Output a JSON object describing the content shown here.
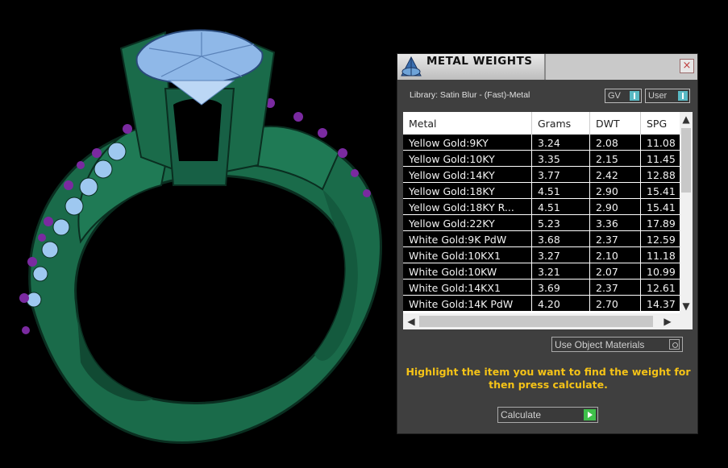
{
  "panel": {
    "title": "METAL WEIGHTS",
    "close_label": "×",
    "library_label": "Library: Satin Blur - (Fast)-Metal",
    "toggle_gv": "GV",
    "toggle_user": "User",
    "use_object_materials": "Use Object Materials",
    "hint": "Highlight the item you want to find the weight for then press calculate.",
    "calculate_label": "Calculate"
  },
  "table": {
    "columns": [
      "Metal",
      "Grams",
      "DWT",
      "SPG"
    ],
    "rows": [
      [
        "Yellow Gold:9KY",
        "3.24",
        "2.08",
        "11.08"
      ],
      [
        "Yellow Gold:10KY",
        "3.35",
        "2.15",
        "11.45"
      ],
      [
        "Yellow Gold:14KY",
        "3.77",
        "2.42",
        "12.88"
      ],
      [
        "Yellow Gold:18KY",
        "4.51",
        "2.90",
        "15.41"
      ],
      [
        "Yellow Gold:18KY R...",
        "4.51",
        "2.90",
        "15.41"
      ],
      [
        "Yellow Gold:22KY",
        "5.23",
        "3.36",
        "17.89"
      ],
      [
        "White Gold:9K PdW",
        "3.68",
        "2.37",
        "12.59"
      ],
      [
        "White Gold:10KX1",
        "3.27",
        "2.10",
        "11.18"
      ],
      [
        "White Gold:10KW",
        "3.21",
        "2.07",
        "10.99"
      ],
      [
        "White Gold:14KX1",
        "3.69",
        "2.37",
        "12.61"
      ],
      [
        "White Gold:14K PdW",
        "4.20",
        "2.70",
        "14.37"
      ]
    ]
  },
  "colors": {
    "ring": "#1e6e4e",
    "stone": "#8fb8e8",
    "accent_stones": "#7a2aa0",
    "hint_text": "#f5c317",
    "toggle_knob": "#59b9c4",
    "go_button": "#3fc04a"
  }
}
